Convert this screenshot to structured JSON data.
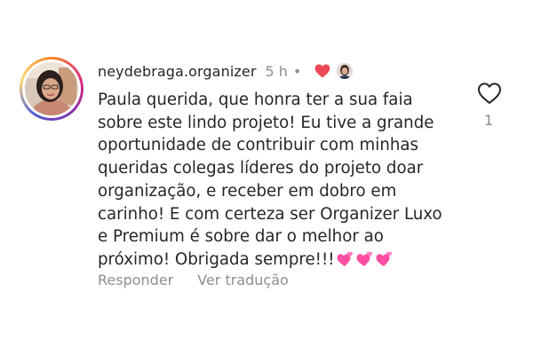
{
  "comment": {
    "username": "neydebraga.organizer",
    "time": "5 h",
    "separator": "•",
    "text": "Paula querida, que honra ter a sua faia\nsobre este lindo projeto! Eu tive a grande\noportunidade de contribuir com minhas\nqueridas colegas líderes do projeto doar\norganização, e receber em dobro em\ncarinho! E com certeza ser Organizer Luxo\ne Premium é sobre dar o melhor ao\npróximo! Obrigada sempre!!!",
    "emojis": [
      "two-hearts-icon",
      "two-hearts-icon",
      "two-hearts-icon"
    ],
    "reply_label": "Responder",
    "translate_label": "Ver tradução",
    "like_count": "1"
  },
  "colors": {
    "text": "#262626",
    "muted": "#8e8e8e",
    "heart": "#ed4956",
    "emoji_pink": "#ff4fa3"
  }
}
